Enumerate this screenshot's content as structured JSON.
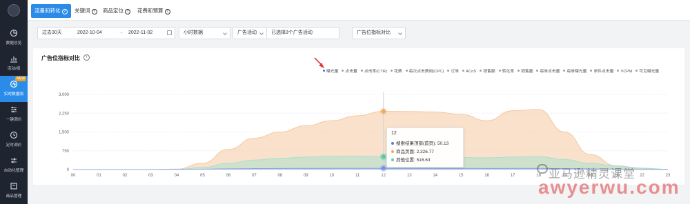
{
  "sidebar": {
    "items": [
      {
        "label": "数据总览",
        "icon": "pie-chart-icon"
      },
      {
        "label": "活动/组",
        "icon": "bar-chart-icon"
      },
      {
        "label": "实时数据流",
        "icon": "realtime-icon",
        "badge": "NEW"
      },
      {
        "label": "一键调价",
        "icon": "adjust-icon"
      },
      {
        "label": "定时调价",
        "icon": "clock-icon"
      },
      {
        "label": "自动化管理",
        "icon": "sliders-icon"
      },
      {
        "label": "商品管理",
        "icon": "box-icon"
      }
    ]
  },
  "tabs": [
    {
      "label": "流量和转化"
    },
    {
      "label": "关键词"
    },
    {
      "label": "商品定位"
    },
    {
      "label": "花费和预算"
    }
  ],
  "filters": {
    "range": "过去30天",
    "date_start": "2022-10-04",
    "date_sep": "→",
    "date_end": "2022-11-02",
    "granularity": "小时数据",
    "type": "广告活动",
    "selected": "已选择3个广告活动",
    "compare": "广告位指标对比"
  },
  "card": {
    "title": "广告位指标对比",
    "info_icon": "i"
  },
  "legend": [
    "曝光量",
    "点击量",
    "点击率(CTR)",
    "花费",
    "每次点击费用(CPC)",
    "订单",
    "ACoS",
    "销售额",
    "转化率",
    "销售量",
    "每单点击量",
    "每单曝光量",
    "单件点击量",
    "VCPM",
    "可见曝光量"
  ],
  "tooltip": {
    "title": "12",
    "rows": [
      {
        "label": "搜索结果顶部(首页)",
        "value": "50.13",
        "color": "#5b7bd5"
      },
      {
        "label": "商品页面",
        "value": "2,326.77",
        "color": "#f0a95c"
      },
      {
        "label": "其他位置",
        "value": "516.63",
        "color": "#5cc9a7"
      }
    ]
  },
  "watermark": {
    "line1": "亚马逊精灵课堂",
    "line2": "awyerwu.com"
  },
  "chart_data": {
    "type": "area",
    "x": [
      "00",
      "01",
      "02",
      "03",
      "04",
      "05",
      "06",
      "07",
      "08",
      "09",
      "10",
      "11",
      "12",
      "13",
      "14",
      "15",
      "16",
      "17",
      "18",
      "19",
      "20",
      "21",
      "22",
      "23"
    ],
    "y_ticks": [
      "0",
      "750",
      "1,500",
      "2,250",
      "3,000"
    ],
    "ylim": [
      0,
      3000
    ],
    "series": [
      {
        "name": "商品页面",
        "color": "#f5c9a0",
        "values": [
          0,
          0,
          0,
          0,
          20,
          250,
          800,
          1250,
          1500,
          1750,
          1950,
          2150,
          2327,
          2320,
          2300,
          2200,
          1950,
          2350,
          2400,
          1500,
          600,
          150,
          30,
          0
        ]
      },
      {
        "name": "其他位置",
        "color": "#a8e1cf",
        "values": [
          0,
          0,
          0,
          0,
          10,
          80,
          250,
          380,
          450,
          500,
          530,
          540,
          517,
          510,
          500,
          480,
          470,
          500,
          520,
          400,
          250,
          150,
          60,
          10
        ]
      },
      {
        "name": "搜索结果顶部(首页)",
        "color": "#8ea5e6",
        "values": [
          0,
          0,
          0,
          0,
          5,
          15,
          30,
          40,
          45,
          48,
          50,
          50,
          50,
          50,
          50,
          48,
          45,
          47,
          48,
          40,
          30,
          20,
          8,
          0
        ]
      }
    ],
    "highlight_index": 12
  }
}
